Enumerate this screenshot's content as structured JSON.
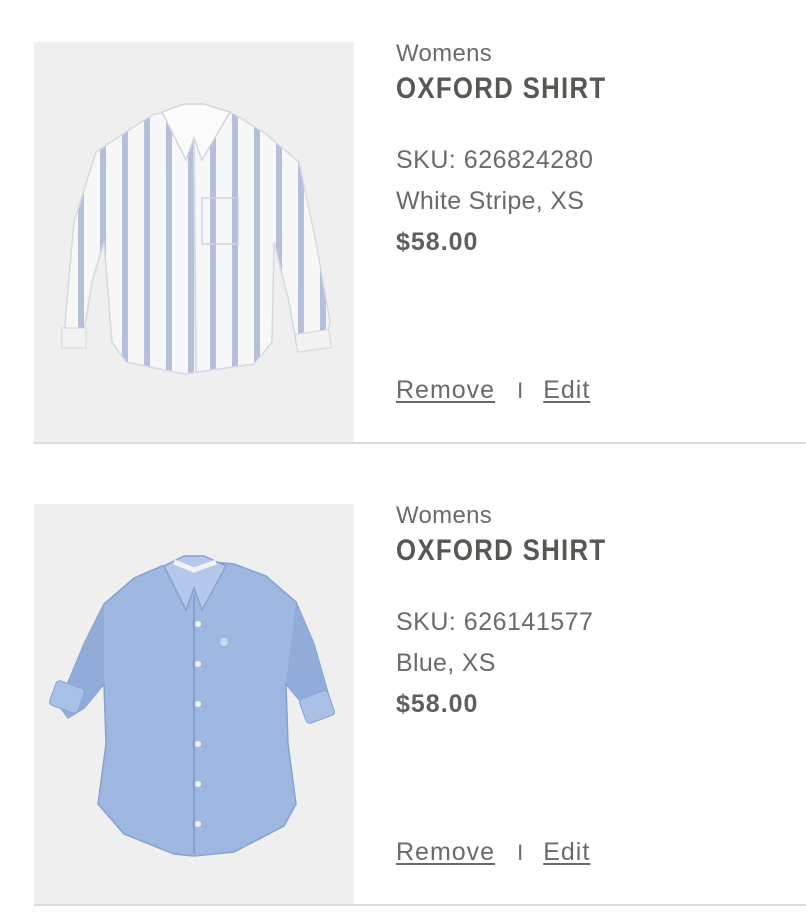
{
  "cart": {
    "items": [
      {
        "category": "Womens",
        "name": "OXFORD SHIRT",
        "sku": "SKU: 626824280",
        "variant": "White Stripe, XS",
        "price": "$58.00",
        "image_icon": "white-stripe-shirt",
        "remove_label": "Remove",
        "separator": "I",
        "edit_label": "Edit"
      },
      {
        "category": "Womens",
        "name": "OXFORD SHIRT",
        "sku": "SKU: 626141577",
        "variant": "Blue, XS",
        "price": "$58.00",
        "image_icon": "blue-oxford-shirt",
        "remove_label": "Remove",
        "separator": "I",
        "edit_label": "Edit"
      }
    ]
  },
  "colors": {
    "text": "#6a6a66",
    "title": "#575753",
    "image_bg": "#efefef",
    "divider": "#dedbd6",
    "shirt_blue": "#9db7e0",
    "stripe_blue": "#aab6d4"
  }
}
